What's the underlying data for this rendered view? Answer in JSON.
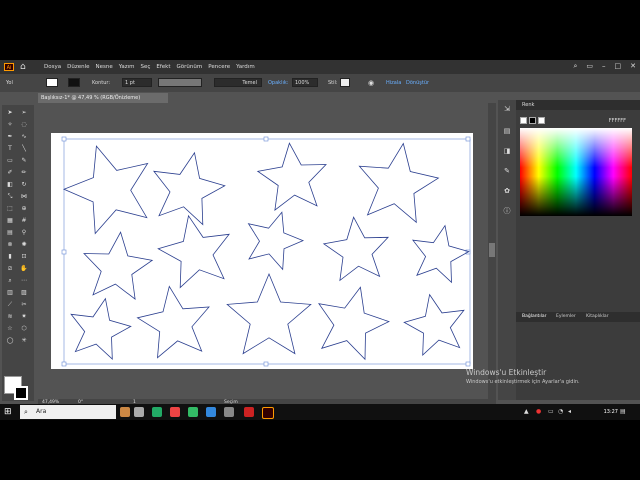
{
  "app": {
    "logo": "Ai"
  },
  "menu": [
    "Dosya",
    "Düzenle",
    "Nesne",
    "Yazım",
    "Seç",
    "Efekt",
    "Görünüm",
    "Pencere",
    "Yardım"
  ],
  "control_bar": {
    "selection_label": "Yol",
    "stroke_label": "Kontur:",
    "stroke_value": "1 pt",
    "profile_label": "Temel",
    "opacity_label": "Opaklık:",
    "opacity_value": "100%",
    "style_label": "Stil:",
    "align_label": "Hizala",
    "transform_label": "Dönüştür"
  },
  "document": {
    "tab_title": "Başlıksız-1* @ 47,49 % (RGB/Önizleme)"
  },
  "status_bar": {
    "zoom": "47,49%",
    "rotation": "0°",
    "artboard_nav": "1",
    "mode": "Seçim"
  },
  "color_panel": {
    "title": "Renk",
    "hex": "FFFFFF"
  },
  "panel_tabs": [
    "Bağlantılar",
    "Eylemler",
    "Kitaplıklar"
  ],
  "watermark": {
    "title": "Windows'u Etkinleştir",
    "subtitle": "Windows'u etkinleştirmek için Ayarlar'a gidin."
  },
  "taskbar": {
    "search_placeholder": "Ara",
    "time": "13:27"
  },
  "colors": {
    "star_stroke": "#2b3f8f",
    "artboard": "#ffffff",
    "workspace": "#535353",
    "accent": "#ff9a00"
  },
  "icons": [
    "home-icon",
    "search-icon",
    "selection-tool-icon",
    "pen-tool-icon",
    "type-tool-icon",
    "rectangle-tool-icon",
    "zoom-tool-icon",
    "hand-tool-icon",
    "windows-start-icon"
  ]
}
